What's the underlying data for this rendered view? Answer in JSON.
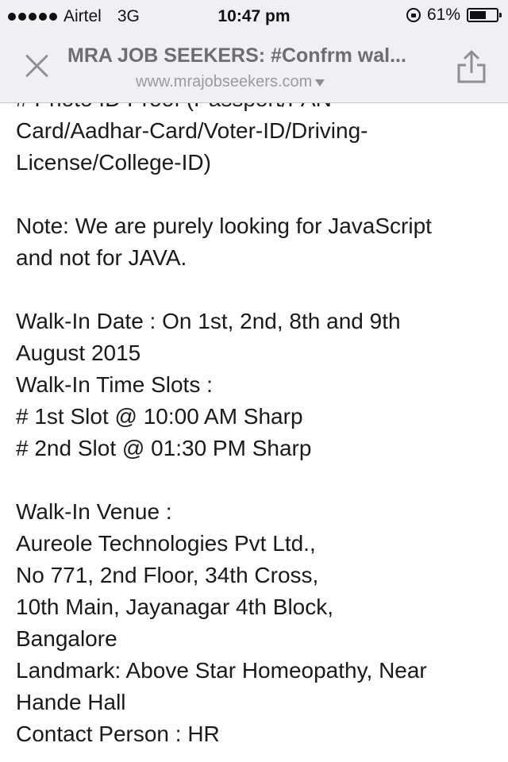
{
  "status_bar": {
    "carrier": "Airtel",
    "network": "3G",
    "time": "10:47 pm",
    "battery_percent": "61%",
    "battery_level": 0.61
  },
  "browser": {
    "title": "MRA JOB SEEKERS: #Confrm wal...",
    "url": "www.mrajobseekers.com"
  },
  "content": {
    "lines": [
      "# Photo ID Proof (Passport/PAN-",
      "Card/Aadhar-Card/Voter-ID/Driving-",
      "License/College-ID)",
      "",
      "Note: We are purely looking for JavaScript",
      "and not for JAVA.",
      "",
      "Walk-In Date : On 1st, 2nd, 8th and 9th",
      "August 2015",
      "Walk-In Time Slots :",
      "# 1st Slot @ 10:00 AM Sharp",
      "# 2nd Slot @ 01:30 PM Sharp",
      "",
      "Walk-In Venue :",
      "Aureole Technologies Pvt Ltd.,",
      "No 771, 2nd Floor, 34th Cross,",
      "10th Main, Jayanagar 4th Block,",
      "Bangalore",
      "Landmark: Above Star Homeopathy, Near",
      "Hande Hall",
      "Contact Person : HR"
    ]
  }
}
